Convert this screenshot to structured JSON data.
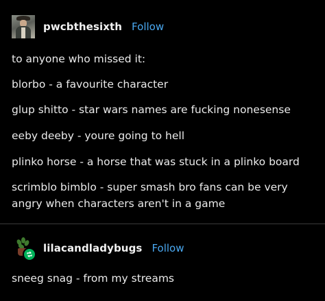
{
  "post1": {
    "username": "pwcbthesixth",
    "follow_label": "Follow",
    "lines": [
      "to anyone who missed it:",
      "blorbo - a favourite character",
      "glup shitto - star wars names are fucking nonesense",
      "eeby deeby - youre going to hell",
      "plinko horse - a horse that was stuck in a plinko board",
      "scrimblo bimblo - super smash bro fans can be very angry when characters aren't in a game"
    ]
  },
  "post2": {
    "username": "lilacandladybugs",
    "follow_label": "Follow",
    "lines": [
      "sneeg snag - from my streams"
    ]
  },
  "colors": {
    "background": "#000000",
    "text": "#ebebeb",
    "follow_link": "#4aa8f0",
    "reblog_badge": "#00b35a",
    "divider": "#3a3a3a"
  },
  "icons": {
    "avatar_1": "person-in-hat-avatar",
    "avatar_2": "potted-plant-avatar",
    "reblog_badge": "reblog-icon"
  }
}
